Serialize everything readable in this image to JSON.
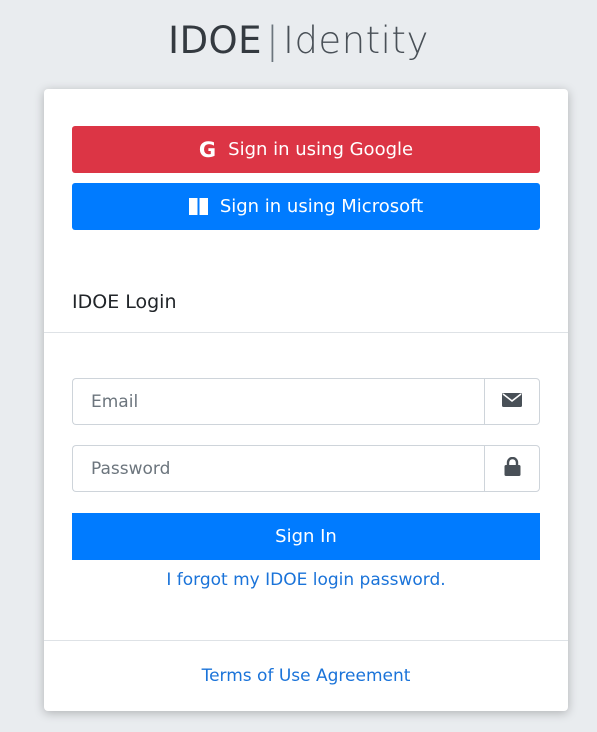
{
  "brand": {
    "primary": "IDOE",
    "separator": "|",
    "secondary": "Identity"
  },
  "sso": {
    "google_label": "Sign in using Google",
    "google_icon_glyph": "G",
    "microsoft_label": "Sign in using Microsoft"
  },
  "login": {
    "title": "IDOE Login",
    "email_placeholder": "Email",
    "email_value": "",
    "password_placeholder": "Password",
    "password_value": "",
    "signin_label": "Sign In",
    "forgot_label": "I forgot my IDOE login password."
  },
  "footer": {
    "terms_label": "Terms of Use Agreement"
  },
  "icons": {
    "google": "google-icon",
    "microsoft": "windows-icon",
    "email": "envelope-icon",
    "password": "lock-icon"
  },
  "colors": {
    "background": "#e9ecef",
    "google_red": "#dc3545",
    "primary_blue": "#007bff",
    "link_blue": "#1a73d9"
  }
}
